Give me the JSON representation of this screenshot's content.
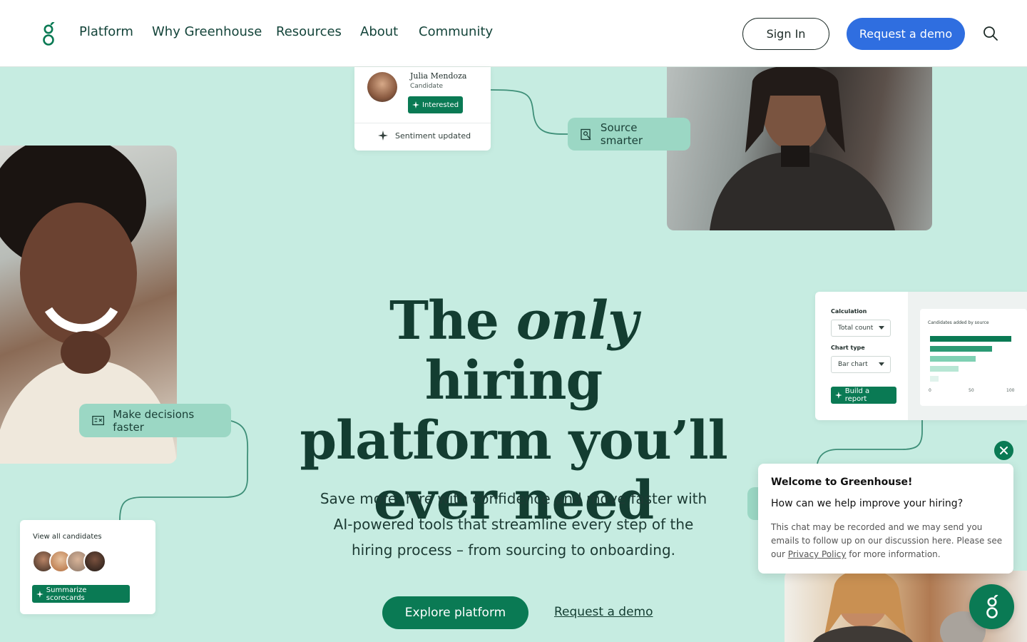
{
  "nav": {
    "items": [
      "Platform",
      "Why Greenhouse",
      "Resources",
      "About",
      "Community"
    ],
    "sign_in": "Sign In",
    "request_demo": "Request a demo"
  },
  "julia_card": {
    "name": "Julia Mendoza",
    "role": "Candidate",
    "pill": "Interested",
    "status": "Sentiment updated"
  },
  "tags": {
    "source": "Source smarter",
    "decide": "Make decisions faster"
  },
  "view_card": {
    "title": "View all candidates",
    "button": "Summarize scorecards"
  },
  "report_card": {
    "calc_label": "Calculation",
    "calc_value": "Total count",
    "chart_type_label": "Chart type",
    "chart_type_value": "Bar chart",
    "button": "Build a report",
    "chart_title": "Candidates added by source",
    "axis_ticks": [
      "0",
      "50",
      "100"
    ]
  },
  "hero": {
    "title_part1": "The ",
    "title_italic": "only",
    "title_part2": " hiring platform you’ll ever need",
    "subtitle": "Save more, hire with confidence and move faster with AI-powered tools that streamline every step of the hiring process – from sourcing to onboarding.",
    "cta_primary": "Explore platform",
    "cta_secondary": "Request a demo"
  },
  "chat": {
    "title": "Welcome to Greenhouse!",
    "question": "How can we help improve your hiring?",
    "note_before": "This chat may be recorded and we may send you emails to follow up on our discussion here. Please see our ",
    "note_link": "Privacy Policy",
    "note_after": " for more information."
  },
  "colors": {
    "background": "#c6ece1",
    "brand_green": "#0a7a54",
    "demo_blue": "#2f6ee0",
    "tag_green": "#9bd7c4"
  },
  "icons": [
    "greenhouse-logo-icon",
    "search-icon",
    "sparkle-icon",
    "person-search-icon",
    "compare-icon",
    "close-icon",
    "chevron-down-icon"
  ]
}
